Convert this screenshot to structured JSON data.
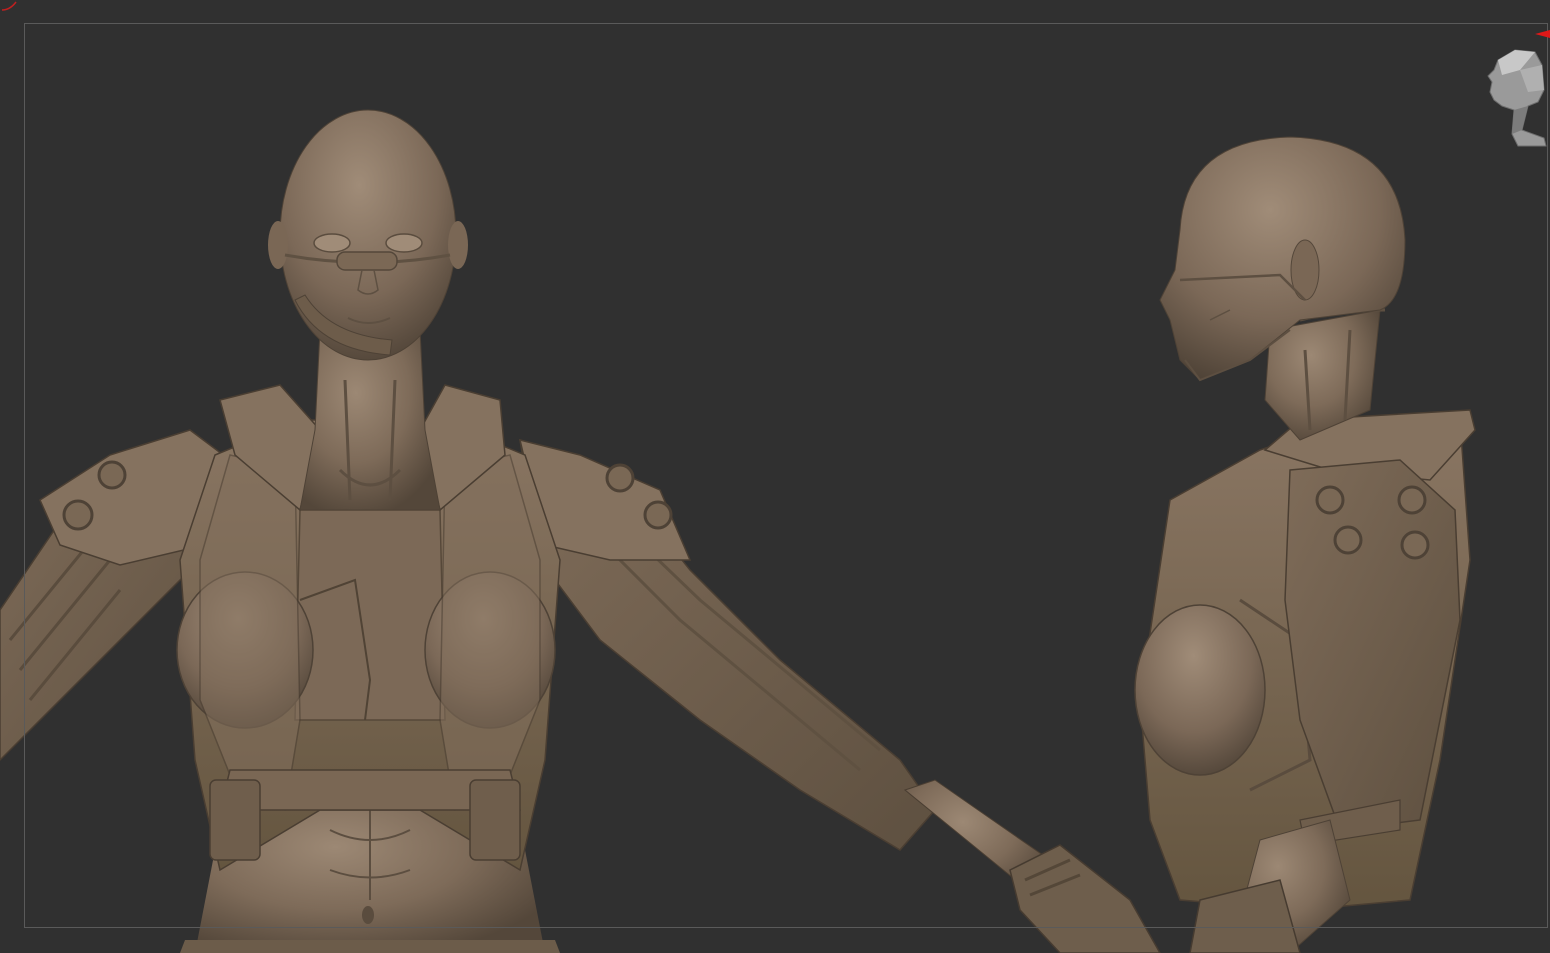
{
  "viewport": {
    "background": "#303030",
    "frame_color": "#5a5a5a",
    "material_base": "#7d6a58",
    "material_light": "#9a8672",
    "material_shadow": "#4e4236"
  },
  "nav_gizmo": {
    "icon": "head-orientation-gizmo-icon",
    "accent_color": "#e01818"
  }
}
